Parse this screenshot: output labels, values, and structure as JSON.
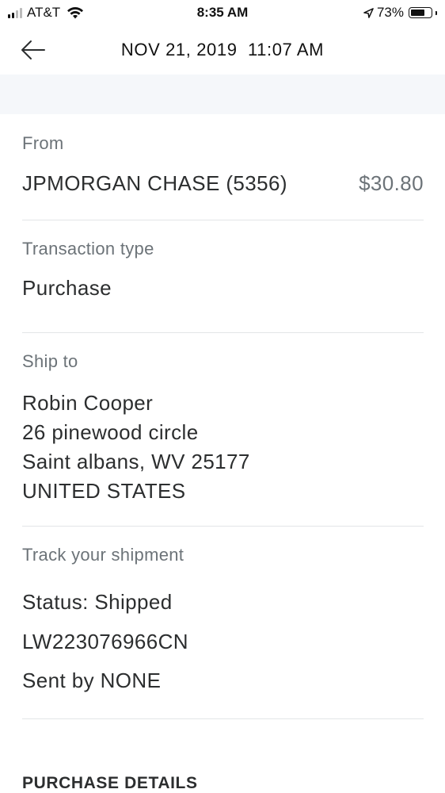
{
  "status_bar": {
    "carrier": "AT&T",
    "time": "8:35 AM",
    "battery": "73%",
    "battery_level": 0.73,
    "icons": [
      "signal-icon",
      "wifi-icon",
      "location-arrow-icon",
      "battery-icon"
    ]
  },
  "header": {
    "back_icon": "arrow-left-icon",
    "title": "NOV 21, 2019  11:07 AM"
  },
  "from": {
    "label": "From",
    "source": "JPMORGAN CHASE (5356)",
    "amount": "$30.80"
  },
  "transaction_type": {
    "label": "Transaction type",
    "value": "Purchase"
  },
  "ship_to": {
    "label": "Ship to",
    "name": "Robin Cooper",
    "street": "26 pinewood circle",
    "city_line": "Saint albans, WV 25177",
    "country": "UNITED STATES"
  },
  "tracking": {
    "label": "Track your shipment",
    "status": "Status: Shipped",
    "number": "LW223076966CN",
    "carrier": "Sent by NONE"
  },
  "purchase_details": {
    "heading": "PURCHASE DETAILS"
  },
  "colors": {
    "text_primary": "#2c2e2f",
    "text_secondary": "#6c7378",
    "divider": "#e3e5e7",
    "band": "#f5f7fa"
  }
}
